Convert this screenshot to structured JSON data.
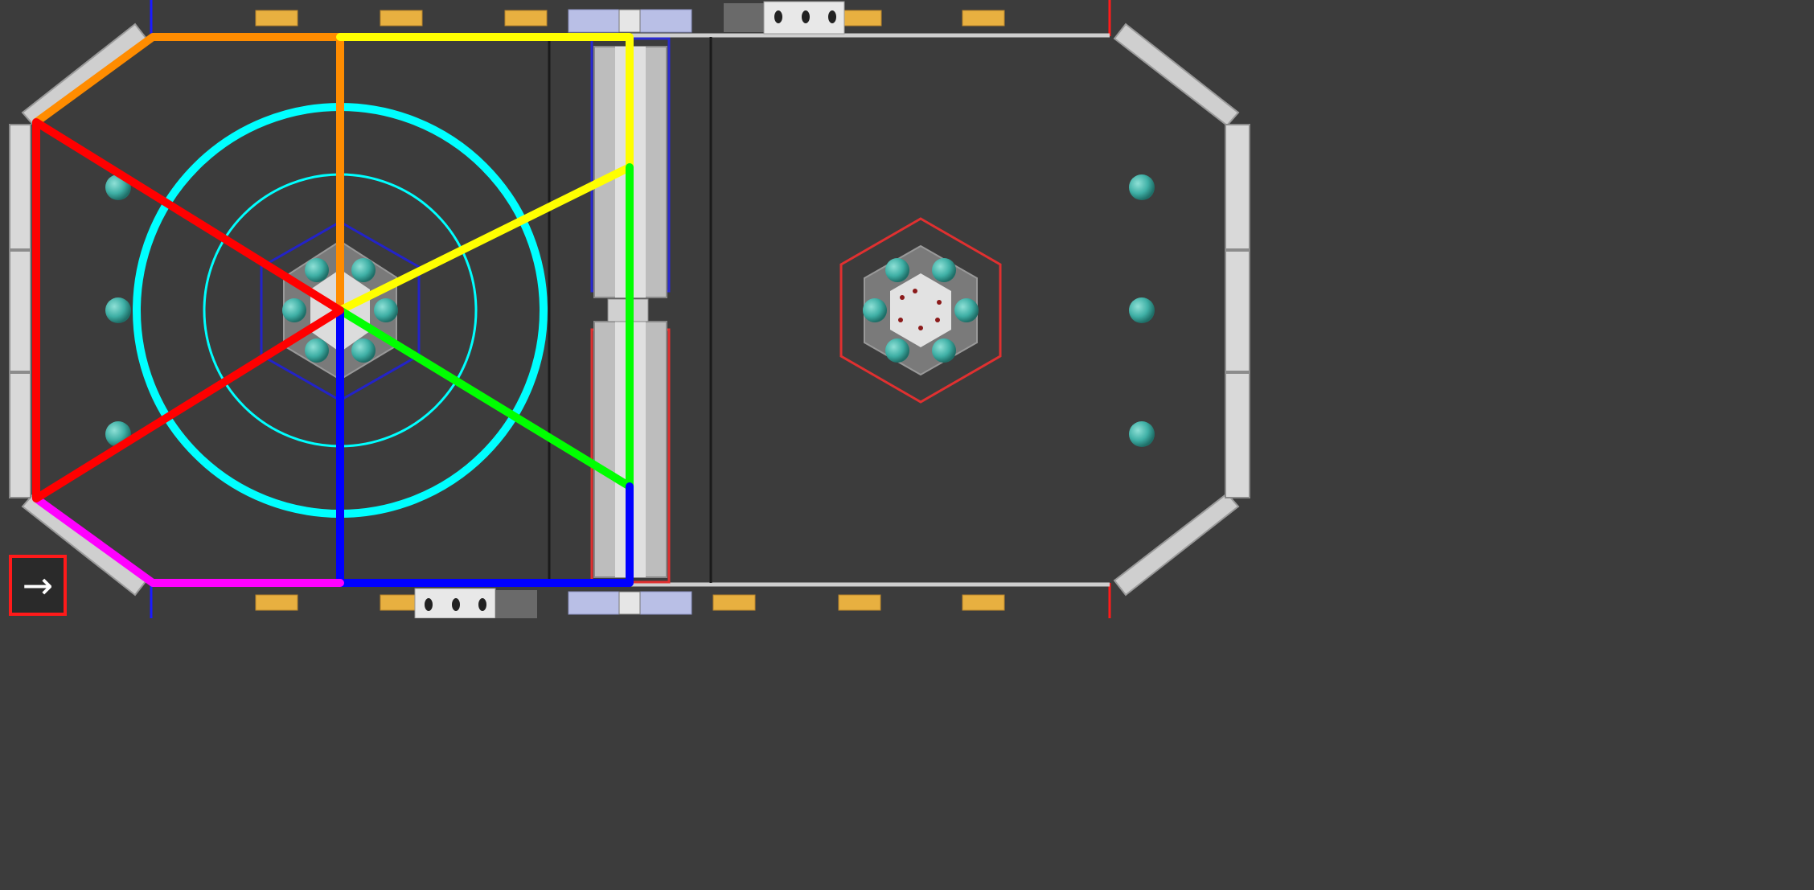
{
  "colors": {
    "background": "#3c3c3c",
    "wall": "#d9d9d9",
    "ball": "#3fb0a6",
    "blue_alliance": "#1a1aff",
    "red_alliance": "#ff1a1a",
    "zone_outline_top_left": "#ff8c00",
    "zone_outline_top_middle": "#ffff00",
    "zone_outline_right_lower": "#00ff00",
    "zone_outline_bottom_middle": "#0000ff",
    "zone_outline_bottom_left": "#ff00ff",
    "zone_outline_left": "#ff0000",
    "range_rings": "#00ffff",
    "platform_pads": "#e8b040"
  },
  "exit_button": {
    "icon": "right-arrow-icon",
    "glyph": "→"
  }
}
